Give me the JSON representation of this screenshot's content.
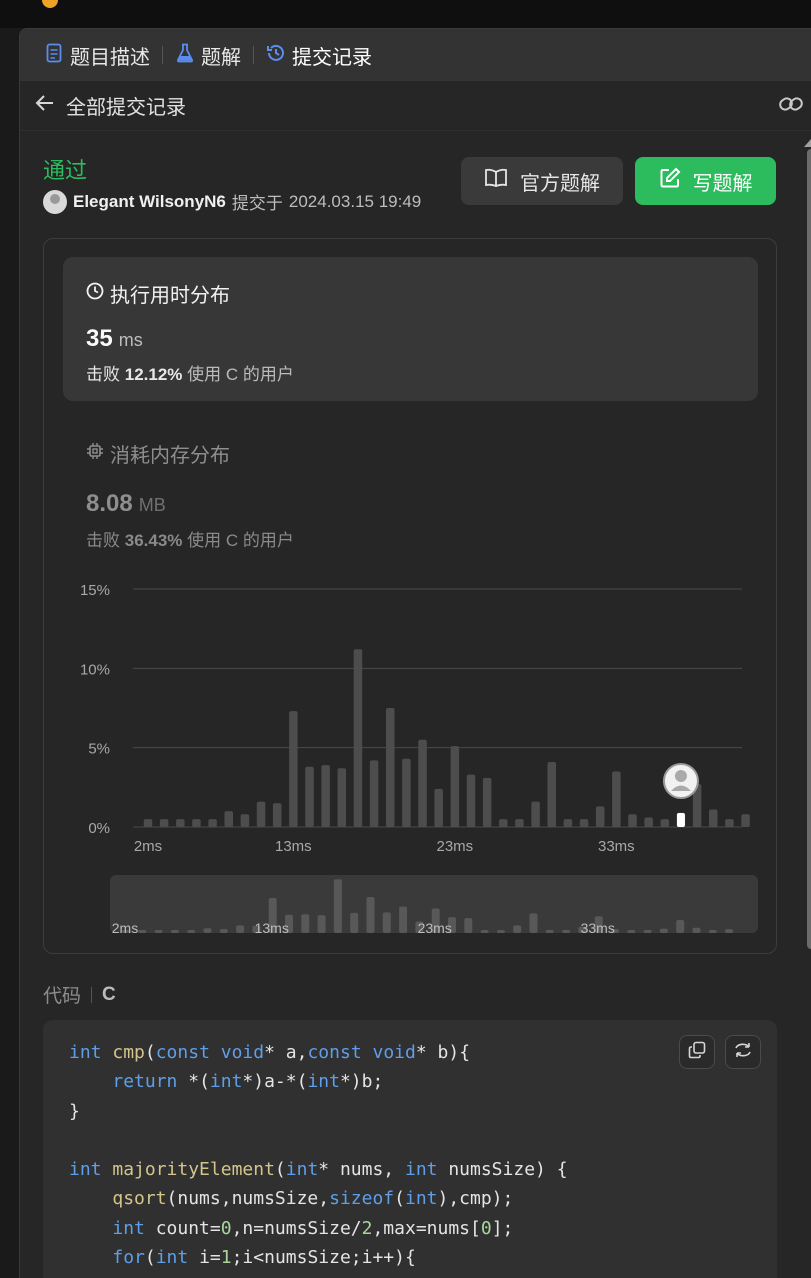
{
  "tabs": {
    "description": "题目描述",
    "solutions": "题解",
    "submissions": "提交记录"
  },
  "subheader": {
    "title": "全部提交记录"
  },
  "submission": {
    "status": "通过",
    "user": "Elegant WilsonyN6",
    "submitted_prefix": "提交于",
    "datetime": "2024.03.15 19:49"
  },
  "buttons": {
    "official": "官方题解",
    "write": "写题解"
  },
  "runtime": {
    "title": "执行用时分布",
    "value": "35",
    "unit": "ms",
    "beat_label": "击败",
    "beat_pct": "12.12%",
    "beat_suffix": "使用 C 的用户"
  },
  "memory": {
    "title": "消耗内存分布",
    "value": "8.08",
    "unit": "MB",
    "beat_label": "击败",
    "beat_pct": "36.43%",
    "beat_suffix": "使用 C 的用户"
  },
  "chart_data": {
    "type": "bar",
    "ylim": [
      0,
      15
    ],
    "y_ticks": [
      "15%",
      "10%",
      "5%",
      "0%"
    ],
    "x_tick_labels": [
      "2ms",
      "13ms",
      "23ms",
      "33ms"
    ],
    "marker_index": 33,
    "values": [
      0.5,
      0.5,
      0.5,
      0.5,
      0.5,
      1.0,
      0.8,
      1.6,
      1.5,
      7.3,
      3.8,
      3.9,
      3.7,
      11.2,
      4.2,
      7.5,
      4.3,
      5.5,
      2.4,
      5.1,
      3.3,
      3.1,
      0.5,
      0.5,
      1.6,
      4.1,
      0.5,
      0.5,
      1.3,
      3.5,
      0.8,
      0.6,
      0.5,
      0.9,
      2.7,
      1.1,
      0.5,
      0.8
    ],
    "grid": true
  },
  "code": {
    "label": "代码",
    "language": "C"
  }
}
